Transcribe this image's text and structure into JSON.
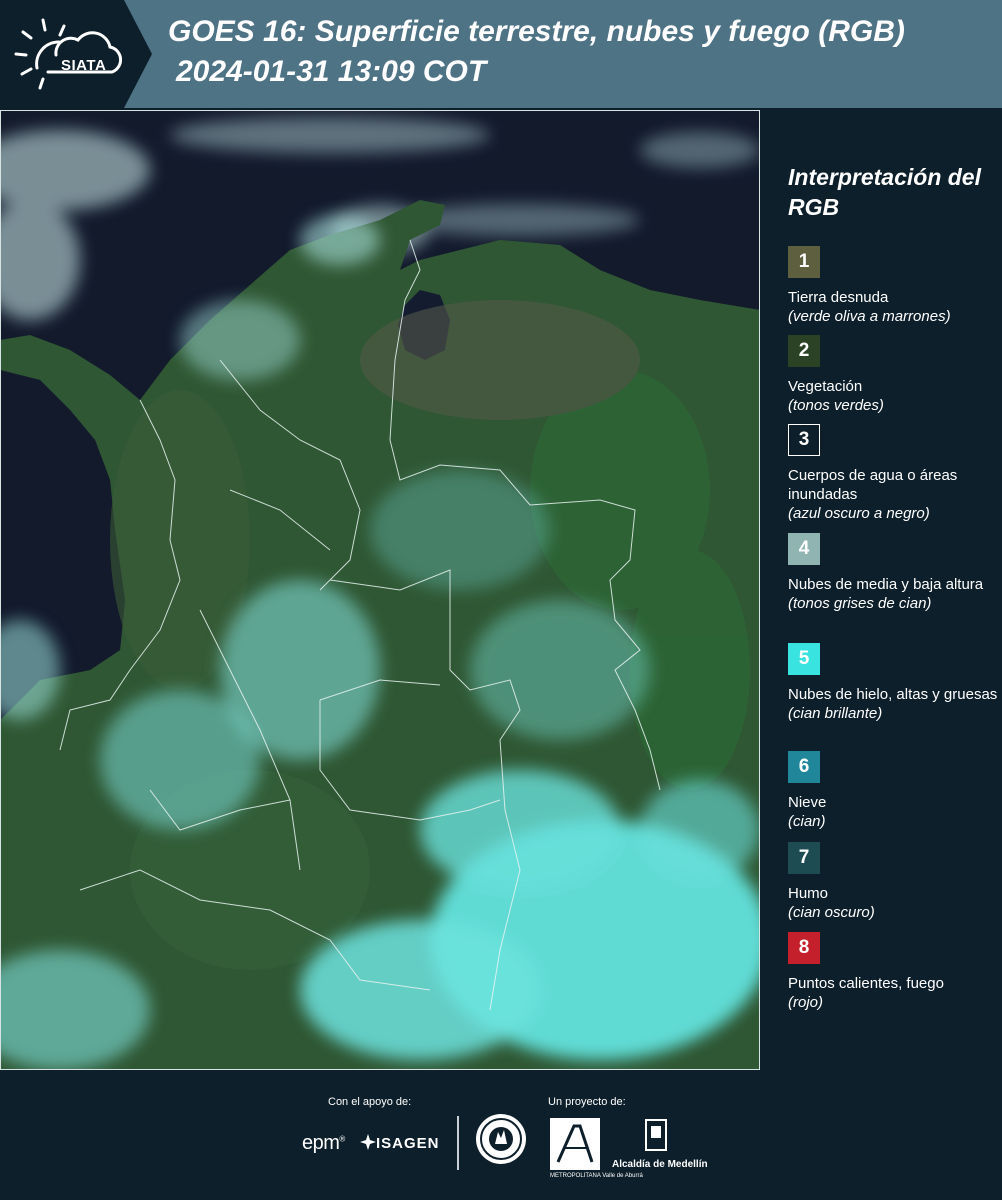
{
  "header": {
    "logo_text": "SIATA",
    "title": "GOES 16: Superficie terrestre, nubes y fuego (RGB)",
    "subtitle": "2024-01-31 13:09 COT"
  },
  "legend": {
    "title": "Interpretación del RGB",
    "items": [
      {
        "number": "1",
        "label": "Tierra desnuda",
        "description": "(verde oliva a marrones)",
        "color": "#5e5f3f"
      },
      {
        "number": "2",
        "label": "Vegetación",
        "description": "(tonos verdes)",
        "color": "#2c4224"
      },
      {
        "number": "3",
        "label": "Cuerpos de agua o áreas inundadas",
        "description": "(azul oscuro a negro)",
        "color": "#0d1f2a"
      },
      {
        "number": "4",
        "label": "Nubes de media y baja altura",
        "description": "(tonos grises de cian)",
        "color": "#8fb4b2"
      },
      {
        "number": "5",
        "label": "Nubes de hielo, altas y gruesas",
        "description": "(cian brillante)",
        "color": "#39e3e0"
      },
      {
        "number": "6",
        "label": "Nieve",
        "description": "(cian)",
        "color": "#20879a"
      },
      {
        "number": "7",
        "label": "Humo",
        "description": "(cian oscuro)",
        "color": "#1d4d53"
      },
      {
        "number": "8",
        "label": "Puntos calientes, fuego",
        "description": "(rojo)",
        "color": "#c4202b"
      }
    ]
  },
  "footer": {
    "support_label": "Con el apoyo de:",
    "project_label": "Un proyecto de:",
    "support_logos": [
      "epm",
      "ISAGEN"
    ],
    "project_logos": [
      "ÁREA METROPOLITANA Valle de Aburrá",
      "Alcaldía de Medellín"
    ],
    "epm_text": "epm",
    "isagen_text": "ISAGEN",
    "area_text": "METROPOLITANA Valle de Aburrá",
    "alcaldia_text": "Alcaldía de Medellín"
  },
  "colors": {
    "background": "#0d1f2a",
    "header_band": "#4d7385",
    "ocean": "#10182a",
    "vegetation": "#2f5a35",
    "cloud_cyan": "#5fe6e2"
  }
}
